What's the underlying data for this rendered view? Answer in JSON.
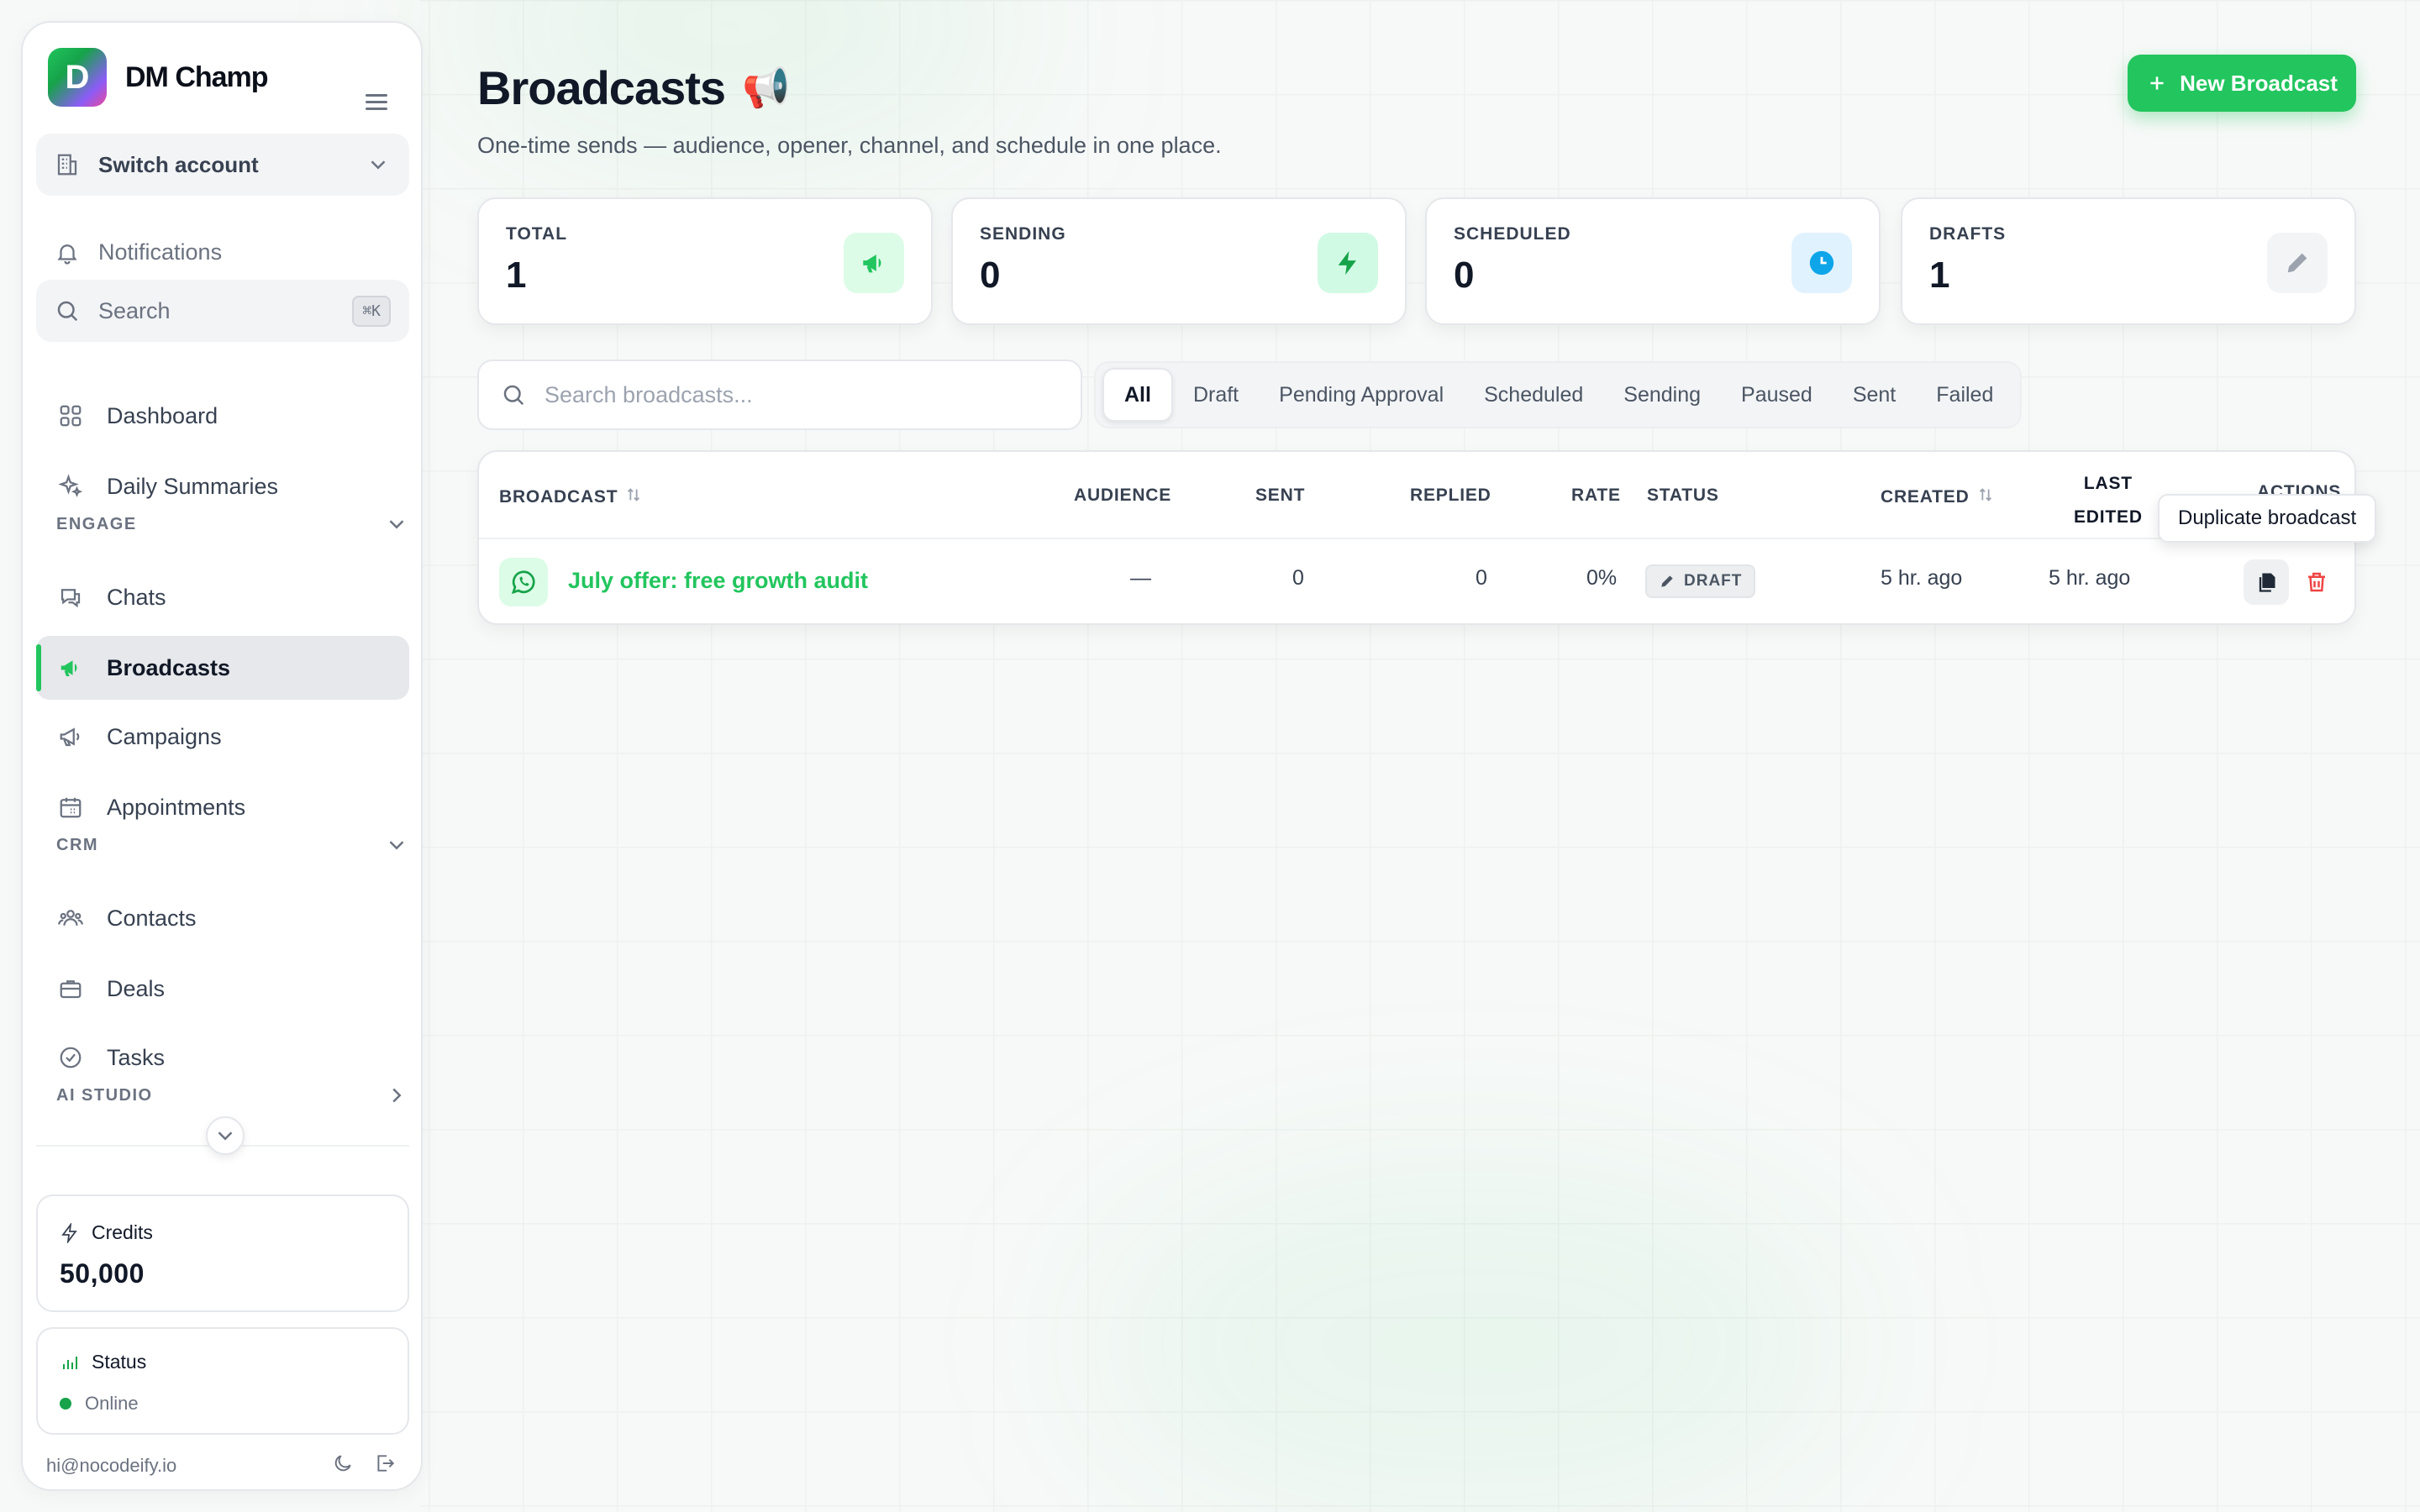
{
  "app": {
    "name": "DM Champ",
    "logo_letter": "D"
  },
  "sidebar": {
    "switch_account": "Switch account",
    "notifications": "Notifications",
    "search_placeholder": "Search",
    "search_shortcut": "⌘K",
    "items": {
      "dashboard": "Dashboard",
      "daily_summaries": "Daily Summaries",
      "chats": "Chats",
      "broadcasts": "Broadcasts",
      "campaigns": "Campaigns",
      "appointments": "Appointments",
      "contacts": "Contacts",
      "deals": "Deals",
      "tasks": "Tasks"
    },
    "sections": {
      "engage": "ENGAGE",
      "crm": "CRM",
      "ai_studio": "AI STUDIO"
    },
    "active": "broadcasts",
    "credits": {
      "label": "Credits",
      "value": "50,000"
    },
    "status": {
      "label": "Status",
      "value": "Online"
    },
    "email": "hi@nocodeify.io"
  },
  "page": {
    "title": "Broadcasts",
    "title_emoji": "📢",
    "subtitle": "One-time sends — audience, opener, channel, and schedule in one place.",
    "new_button": "New Broadcast"
  },
  "stats": [
    {
      "label": "TOTAL",
      "value": "1",
      "icon": "megaphone-icon",
      "color": "#22c55e",
      "bg": "#dcfce7"
    },
    {
      "label": "SENDING",
      "value": "0",
      "icon": "bolt-icon",
      "color": "#16a34a",
      "bg": "#d1fae5"
    },
    {
      "label": "SCHEDULED",
      "value": "0",
      "icon": "clock-icon",
      "color": "#0ea5e9",
      "bg": "#e0f2fe"
    },
    {
      "label": "DRAFTS",
      "value": "1",
      "icon": "pencil-icon",
      "color": "#9ca3af",
      "bg": "#f3f4f6"
    }
  ],
  "filters": {
    "search_placeholder": "Search broadcasts...",
    "tabs": [
      "All",
      "Draft",
      "Pending Approval",
      "Scheduled",
      "Sending",
      "Paused",
      "Sent",
      "Failed"
    ],
    "active": "All"
  },
  "table": {
    "headers": {
      "broadcast": "BROADCAST",
      "audience": "AUDIENCE",
      "sent": "SENT",
      "replied": "REPLIED",
      "rate": "RATE",
      "status": "STATUS",
      "created": "CREATED",
      "last_edited_1": "LAST",
      "last_edited_2": "EDITED",
      "actions": "ACTIONS"
    },
    "rows": [
      {
        "name": "July offer: free growth audit",
        "channel": "whatsapp-icon",
        "audience": "—",
        "sent": "0",
        "replied": "0",
        "rate": "0%",
        "status": "DRAFT",
        "created": "5 hr. ago",
        "last_edited": "5 hr. ago"
      }
    ]
  },
  "tooltip": "Duplicate broadcast",
  "colors": {
    "accent": "#22c55e",
    "danger": "#ef4444"
  }
}
